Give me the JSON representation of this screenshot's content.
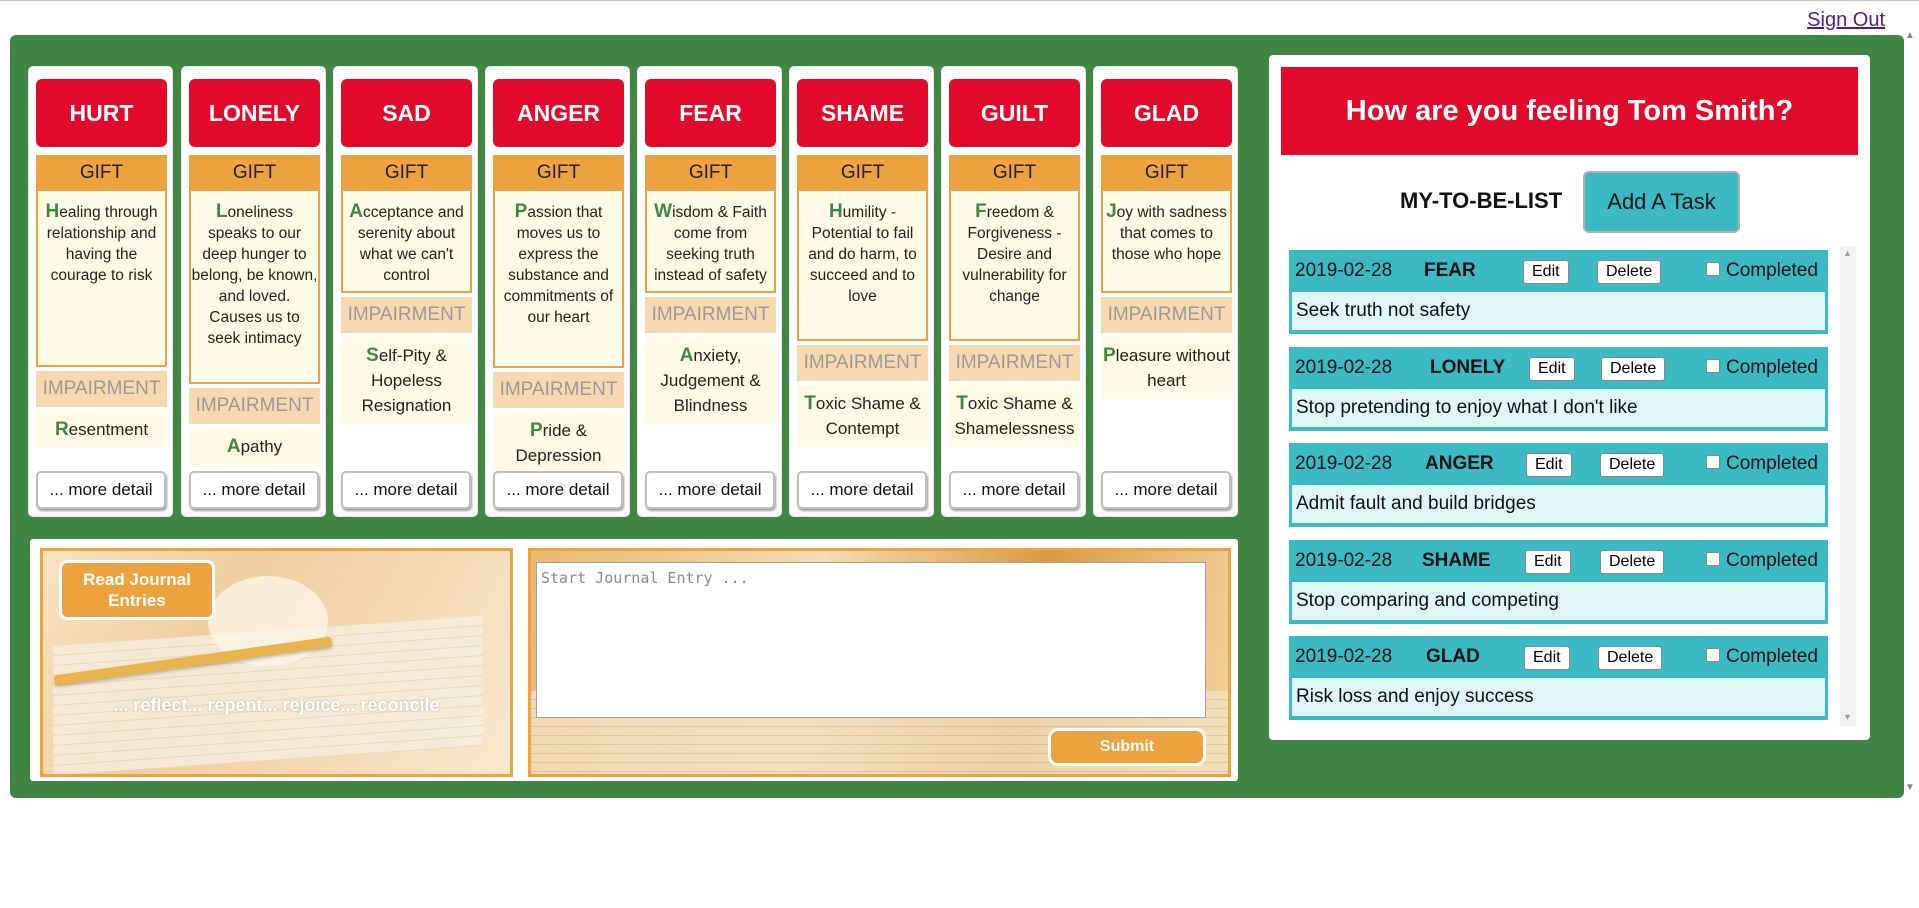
{
  "header": {
    "sign_out": "Sign Out"
  },
  "emotions": [
    {
      "name": "HURT",
      "gift_label": "GIFT",
      "gift_initial": "H",
      "gift_rest": "ealing through relationship and having the courage to risk",
      "impairment_label": "IMPAIRMENT",
      "imp_initial": "R",
      "imp_rest": "esentment",
      "more": "... more detail"
    },
    {
      "name": "LONELY",
      "gift_label": "GIFT",
      "gift_initial": "L",
      "gift_rest": "oneliness speaks to our deep hunger to belong, be known, and loved. Causes us to seek intimacy",
      "impairment_label": "IMPAIRMENT",
      "imp_initial": "A",
      "imp_rest": "pathy",
      "more": "... more detail"
    },
    {
      "name": "SAD",
      "gift_label": "GIFT",
      "gift_initial": "A",
      "gift_rest": "cceptance and serenity about what we can't control",
      "impairment_label": "IMPAIRMENT",
      "imp_initial": "S",
      "imp_rest": "elf-Pity & Hopeless Resignation",
      "more": "... more detail"
    },
    {
      "name": "ANGER",
      "gift_label": "GIFT",
      "gift_initial": "P",
      "gift_rest": "assion that moves us to express the substance and commitments of our heart",
      "impairment_label": "IMPAIRMENT",
      "imp_initial": "P",
      "imp_rest": "ride & Depression",
      "more": "... more detail"
    },
    {
      "name": "FEAR",
      "gift_label": "GIFT",
      "gift_initial": "W",
      "gift_rest": "isdom & Faith come from seeking truth instead of safety",
      "impairment_label": "IMPAIRMENT",
      "imp_initial": "A",
      "imp_rest": "nxiety, Judgement & Blindness",
      "more": "... more detail"
    },
    {
      "name": "SHAME",
      "gift_label": "GIFT",
      "gift_initial": "H",
      "gift_rest": "umility - Potential to fail and do harm, to succeed and to love",
      "impairment_label": "IMPAIRMENT",
      "imp_initial": "T",
      "imp_rest": "oxic Shame & Contempt",
      "more": "... more detail"
    },
    {
      "name": "GUILT",
      "gift_label": "GIFT",
      "gift_initial": "F",
      "gift_rest": "reedom & Forgiveness - Desire and vulnerability for change",
      "impairment_label": "IMPAIRMENT",
      "imp_initial": "T",
      "imp_rest": "oxic Shame & Shamelessness",
      "more": "... more detail"
    },
    {
      "name": "GLAD",
      "gift_label": "GIFT",
      "gift_initial": "J",
      "gift_rest": "oy with sadness that comes to those who hope",
      "impairment_label": "IMPAIRMENT",
      "imp_initial": "P",
      "imp_rest": "leasure without heart",
      "more": "... more detail"
    }
  ],
  "journal": {
    "read_button": "Read Journal Entries",
    "tagline": "... reflect... repent... rejoice... reconcile",
    "placeholder": "Start Journal Entry ...",
    "submit": "Submit"
  },
  "todo": {
    "heading": "How are you feeling Tom Smith?",
    "list_title": "MY-TO-BE-LIST",
    "add_task": "Add A Task",
    "edit_label": "Edit",
    "delete_label": "Delete",
    "completed_label": "Completed",
    "tasks": [
      {
        "date": "2019-02-28",
        "emotion": "FEAR",
        "text": "Seek truth not safety",
        "completed": false
      },
      {
        "date": "2019-02-28",
        "emotion": "LONELY",
        "text": "Stop pretending to enjoy what I don't like",
        "completed": false
      },
      {
        "date": "2019-02-28",
        "emotion": "ANGER",
        "text": "Admit fault and build bridges",
        "completed": false
      },
      {
        "date": "2019-02-28",
        "emotion": "SHAME",
        "text": "Stop comparing and competing",
        "completed": false
      },
      {
        "date": "2019-02-28",
        "emotion": "GLAD",
        "text": "Risk loss and enjoy success",
        "completed": false
      }
    ]
  },
  "colors": {
    "green": "#3f8644",
    "red": "#e20a2b",
    "orange": "#eca33f",
    "teal": "#3bbac4"
  }
}
